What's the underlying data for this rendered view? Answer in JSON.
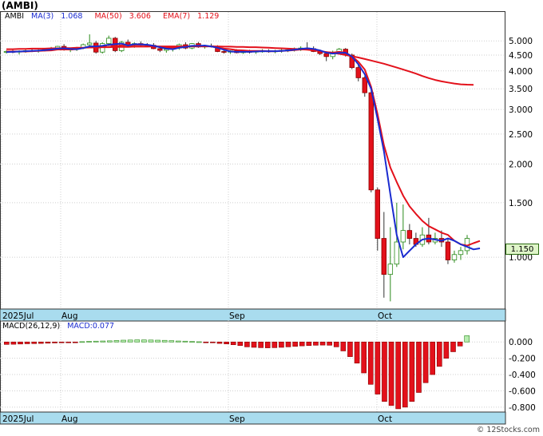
{
  "chart_data": [
    {
      "type": "candlestick",
      "ticker_label": "(AMBI)",
      "y_scale": "log",
      "ylim": [
        0.68,
        6.2
      ],
      "ytick_labels": [
        "5.000",
        "4.500",
        "4.000",
        "3.500",
        "3.000",
        "2.500",
        "2.000",
        "1.500",
        "1.000"
      ],
      "ytick_values": [
        5.0,
        4.5,
        4.0,
        3.5,
        3.0,
        2.5,
        2.0,
        1.5,
        1.0
      ],
      "x_labels": [
        "2025Jul",
        "Aug",
        "Sep",
        "Oct"
      ],
      "last_price_label": "1.150",
      "last_price": 1.15,
      "indicators": [
        {
          "label": "AMBI",
          "value": "",
          "color": "#000000"
        },
        {
          "label": "MA(3)",
          "value": "1.068",
          "color": "#1a2bd0"
        },
        {
          "label": "MA(50)",
          "value": "3.606",
          "color": "#e3111b"
        },
        {
          "label": "EMA(7)",
          "value": "1.129",
          "color": "#e3111b"
        }
      ],
      "colors": {
        "up": "#ffffff",
        "down": "#e3111b",
        "ma_short": "#1a2bd0",
        "ma_long": "#e3111b",
        "x_band": "#a9dcee"
      },
      "candles": [
        {
          "o": 4.6,
          "h": 4.66,
          "l": 4.55,
          "c": 4.62
        },
        {
          "o": 4.62,
          "h": 4.68,
          "l": 4.56,
          "c": 4.6
        },
        {
          "o": 4.6,
          "h": 4.66,
          "l": 4.52,
          "c": 4.63
        },
        {
          "o": 4.63,
          "h": 4.7,
          "l": 4.58,
          "c": 4.65
        },
        {
          "o": 4.65,
          "h": 4.72,
          "l": 4.6,
          "c": 4.64
        },
        {
          "o": 4.64,
          "h": 4.7,
          "l": 4.58,
          "c": 4.66
        },
        {
          "o": 4.66,
          "h": 4.74,
          "l": 4.62,
          "c": 4.7
        },
        {
          "o": 4.7,
          "h": 4.78,
          "l": 4.64,
          "c": 4.72
        },
        {
          "o": 4.72,
          "h": 4.82,
          "l": 4.66,
          "c": 4.8
        },
        {
          "o": 4.8,
          "h": 4.88,
          "l": 4.65,
          "c": 4.68
        },
        {
          "o": 4.68,
          "h": 4.75,
          "l": 4.6,
          "c": 4.7
        },
        {
          "o": 4.7,
          "h": 4.78,
          "l": 4.64,
          "c": 4.74
        },
        {
          "o": 4.74,
          "h": 4.9,
          "l": 4.7,
          "c": 4.86
        },
        {
          "o": 4.86,
          "h": 5.25,
          "l": 4.78,
          "c": 4.92
        },
        {
          "o": 4.92,
          "h": 5.0,
          "l": 4.55,
          "c": 4.6
        },
        {
          "o": 4.6,
          "h": 4.95,
          "l": 4.55,
          "c": 4.9
        },
        {
          "o": 4.9,
          "h": 5.2,
          "l": 4.8,
          "c": 5.1
        },
        {
          "o": 5.1,
          "h": 5.15,
          "l": 4.6,
          "c": 4.65
        },
        {
          "o": 4.65,
          "h": 5.0,
          "l": 4.6,
          "c": 4.95
        },
        {
          "o": 4.95,
          "h": 5.05,
          "l": 4.8,
          "c": 4.85
        },
        {
          "o": 4.85,
          "h": 4.95,
          "l": 4.75,
          "c": 4.9
        },
        {
          "o": 4.9,
          "h": 4.98,
          "l": 4.82,
          "c": 4.86
        },
        {
          "o": 4.86,
          "h": 4.92,
          "l": 4.8,
          "c": 4.84
        },
        {
          "o": 4.84,
          "h": 4.92,
          "l": 4.7,
          "c": 4.72
        },
        {
          "o": 4.72,
          "h": 4.78,
          "l": 4.6,
          "c": 4.66
        },
        {
          "o": 4.66,
          "h": 4.74,
          "l": 4.58,
          "c": 4.7
        },
        {
          "o": 4.7,
          "h": 4.8,
          "l": 4.62,
          "c": 4.74
        },
        {
          "o": 4.74,
          "h": 4.9,
          "l": 4.68,
          "c": 4.86
        },
        {
          "o": 4.86,
          "h": 4.95,
          "l": 4.7,
          "c": 4.74
        },
        {
          "o": 4.74,
          "h": 4.92,
          "l": 4.7,
          "c": 4.9
        },
        {
          "o": 4.9,
          "h": 4.96,
          "l": 4.75,
          "c": 4.78
        },
        {
          "o": 4.78,
          "h": 4.86,
          "l": 4.72,
          "c": 4.82
        },
        {
          "o": 4.82,
          "h": 4.9,
          "l": 4.76,
          "c": 4.8
        },
        {
          "o": 4.8,
          "h": 4.84,
          "l": 4.6,
          "c": 4.62
        },
        {
          "o": 4.62,
          "h": 4.68,
          "l": 4.55,
          "c": 4.6
        },
        {
          "o": 4.6,
          "h": 4.66,
          "l": 4.54,
          "c": 4.64
        },
        {
          "o": 4.64,
          "h": 4.7,
          "l": 4.56,
          "c": 4.58
        },
        {
          "o": 4.58,
          "h": 4.66,
          "l": 4.54,
          "c": 4.62
        },
        {
          "o": 4.62,
          "h": 4.68,
          "l": 4.55,
          "c": 4.6
        },
        {
          "o": 4.6,
          "h": 4.66,
          "l": 4.54,
          "c": 4.63
        },
        {
          "o": 4.63,
          "h": 4.7,
          "l": 4.58,
          "c": 4.64
        },
        {
          "o": 4.64,
          "h": 4.7,
          "l": 4.58,
          "c": 4.62
        },
        {
          "o": 4.62,
          "h": 4.68,
          "l": 4.56,
          "c": 4.64
        },
        {
          "o": 4.64,
          "h": 4.72,
          "l": 4.58,
          "c": 4.66
        },
        {
          "o": 4.66,
          "h": 4.72,
          "l": 4.6,
          "c": 4.68
        },
        {
          "o": 4.68,
          "h": 4.76,
          "l": 4.62,
          "c": 4.72
        },
        {
          "o": 4.72,
          "h": 4.8,
          "l": 4.64,
          "c": 4.74
        },
        {
          "o": 4.74,
          "h": 4.95,
          "l": 4.68,
          "c": 4.72
        },
        {
          "o": 4.72,
          "h": 4.8,
          "l": 4.6,
          "c": 4.62
        },
        {
          "o": 4.62,
          "h": 4.68,
          "l": 4.5,
          "c": 4.55
        },
        {
          "o": 4.55,
          "h": 4.62,
          "l": 4.3,
          "c": 4.45
        },
        {
          "o": 4.45,
          "h": 4.65,
          "l": 4.36,
          "c": 4.6
        },
        {
          "o": 4.6,
          "h": 4.74,
          "l": 4.56,
          "c": 4.7
        },
        {
          "o": 4.7,
          "h": 4.74,
          "l": 4.45,
          "c": 4.5
        },
        {
          "o": 4.5,
          "h": 4.55,
          "l": 4.05,
          "c": 4.1
        },
        {
          "o": 4.1,
          "h": 4.2,
          "l": 3.7,
          "c": 3.8
        },
        {
          "o": 3.8,
          "h": 3.85,
          "l": 3.3,
          "c": 3.4
        },
        {
          "o": 3.4,
          "h": 3.45,
          "l": 1.62,
          "c": 1.65
        },
        {
          "o": 1.65,
          "h": 1.68,
          "l": 1.05,
          "c": 1.15
        },
        {
          "o": 1.15,
          "h": 1.4,
          "l": 0.74,
          "c": 0.88
        },
        {
          "o": 0.88,
          "h": 1.25,
          "l": 0.72,
          "c": 0.95
        },
        {
          "o": 0.95,
          "h": 1.5,
          "l": 0.93,
          "c": 1.12
        },
        {
          "o": 1.12,
          "h": 1.48,
          "l": 1.06,
          "c": 1.22
        },
        {
          "o": 1.22,
          "h": 1.28,
          "l": 1.1,
          "c": 1.15
        },
        {
          "o": 1.15,
          "h": 1.2,
          "l": 1.08,
          "c": 1.1
        },
        {
          "o": 1.1,
          "h": 1.25,
          "l": 1.08,
          "c": 1.18
        },
        {
          "o": 1.18,
          "h": 1.34,
          "l": 1.1,
          "c": 1.12
        },
        {
          "o": 1.12,
          "h": 1.2,
          "l": 1.1,
          "c": 1.15
        },
        {
          "o": 1.15,
          "h": 1.22,
          "l": 1.08,
          "c": 1.12
        },
        {
          "o": 1.12,
          "h": 1.15,
          "l": 0.95,
          "c": 0.98
        },
        {
          "o": 0.98,
          "h": 1.05,
          "l": 0.96,
          "c": 1.02
        },
        {
          "o": 1.02,
          "h": 1.08,
          "l": 0.98,
          "c": 1.05
        },
        {
          "o": 1.05,
          "h": 1.18,
          "l": 1.02,
          "c": 1.15
        }
      ],
      "ma_short": [
        4.6,
        4.61,
        4.62,
        4.63,
        4.64,
        4.65,
        4.67,
        4.69,
        4.72,
        4.73,
        4.71,
        4.7,
        4.74,
        4.8,
        4.8,
        4.82,
        4.86,
        4.88,
        4.9,
        4.83,
        4.88,
        4.87,
        4.86,
        4.82,
        4.77,
        4.72,
        4.7,
        4.75,
        4.78,
        4.82,
        4.82,
        4.83,
        4.8,
        4.75,
        4.68,
        4.62,
        4.61,
        4.61,
        4.61,
        4.62,
        4.63,
        4.63,
        4.63,
        4.64,
        4.66,
        4.68,
        4.71,
        4.73,
        4.71,
        4.66,
        4.58,
        4.55,
        4.57,
        4.58,
        4.45,
        4.2,
        3.9,
        3.5,
        2.8,
        2.2,
        1.6,
        1.18,
        1.0,
        1.05,
        1.1,
        1.14,
        1.15,
        1.14,
        1.13,
        1.15,
        1.13,
        1.1,
        1.08,
        1.06,
        1.068
      ],
      "ma_long": [
        4.7,
        4.7,
        4.71,
        4.71,
        4.72,
        4.72,
        4.72,
        4.73,
        4.73,
        4.74,
        4.74,
        4.75,
        4.75,
        4.76,
        4.76,
        4.77,
        4.77,
        4.78,
        4.78,
        4.78,
        4.79,
        4.79,
        4.79,
        4.8,
        4.8,
        4.8,
        4.8,
        4.8,
        4.8,
        4.8,
        4.8,
        4.8,
        4.8,
        4.8,
        4.79,
        4.79,
        4.78,
        4.78,
        4.77,
        4.77,
        4.76,
        4.75,
        4.74,
        4.73,
        4.72,
        4.71,
        4.7,
        4.68,
        4.66,
        4.63,
        4.6,
        4.57,
        4.54,
        4.5,
        4.46,
        4.42,
        4.37,
        4.32,
        4.27,
        4.22,
        4.16,
        4.1,
        4.04,
        3.98,
        3.92,
        3.85,
        3.79,
        3.74,
        3.7,
        3.67,
        3.64,
        3.62,
        3.61,
        3.606
      ],
      "ema": [
        4.62,
        4.62,
        4.62,
        4.62,
        4.63,
        4.64,
        4.65,
        4.66,
        4.69,
        4.69,
        4.69,
        4.7,
        4.74,
        4.79,
        4.74,
        4.78,
        4.86,
        4.8,
        4.84,
        4.84,
        4.85,
        4.85,
        4.85,
        4.82,
        4.78,
        4.76,
        4.76,
        4.79,
        4.78,
        4.81,
        4.8,
        4.81,
        4.8,
        4.76,
        4.72,
        4.7,
        4.67,
        4.66,
        4.64,
        4.64,
        4.64,
        4.63,
        4.63,
        4.64,
        4.65,
        4.67,
        4.69,
        4.7,
        4.68,
        4.64,
        4.6,
        4.58,
        4.61,
        4.58,
        4.46,
        4.28,
        4.04,
        3.55,
        2.9,
        2.3,
        1.95,
        1.75,
        1.58,
        1.46,
        1.38,
        1.31,
        1.26,
        1.23,
        1.2,
        1.18,
        1.13,
        1.1,
        1.09,
        1.11,
        1.129
      ]
    },
    {
      "type": "bar",
      "macd_label": "MACD(26,12,9)",
      "macd_value_label": "MACD:0.077",
      "ylim": [
        -0.86,
        0.12
      ],
      "ytick_labels": [
        "0.000",
        "-0.200",
        "-0.400",
        "-0.600",
        "-0.800"
      ],
      "ytick_values": [
        0.0,
        -0.2,
        -0.4,
        -0.6,
        -0.8
      ],
      "x_labels": [
        "2025Jul",
        "Aug",
        "Sep",
        "Oct"
      ],
      "values": [
        -0.03,
        -0.028,
        -0.025,
        -0.022,
        -0.02,
        -0.018,
        -0.015,
        -0.012,
        -0.01,
        -0.006,
        -0.004,
        0.004,
        0.008,
        0.01,
        0.012,
        0.014,
        0.018,
        0.022,
        0.024,
        0.026,
        0.025,
        0.024,
        0.022,
        0.02,
        0.016,
        0.012,
        0.01,
        0.006,
        0.003,
        -0.004,
        -0.01,
        -0.018,
        -0.024,
        -0.034,
        -0.044,
        -0.06,
        -0.066,
        -0.07,
        -0.072,
        -0.07,
        -0.066,
        -0.06,
        -0.054,
        -0.048,
        -0.044,
        -0.04,
        -0.038,
        -0.04,
        -0.06,
        -0.11,
        -0.18,
        -0.26,
        -0.38,
        -0.52,
        -0.64,
        -0.73,
        -0.78,
        -0.82,
        -0.8,
        -0.73,
        -0.62,
        -0.5,
        -0.4,
        -0.3,
        -0.2,
        -0.12,
        -0.05,
        0.077
      ]
    }
  ],
  "watermark": "© 12Stocks.com"
}
